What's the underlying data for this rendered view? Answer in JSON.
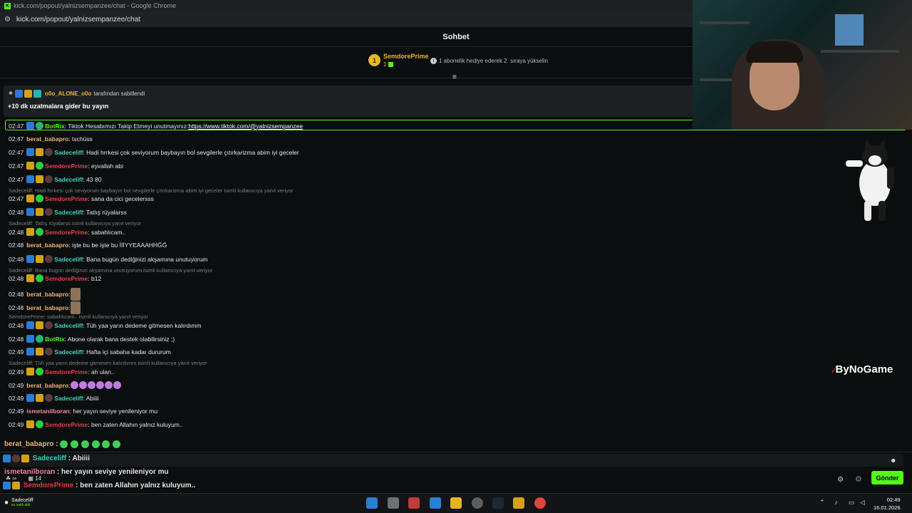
{
  "window": {
    "title": "kick.com/popout/yalnizsempanzee/chat - Google Chrome",
    "url": "kick.com/popout/yalnizsempanzee/chat"
  },
  "chat": {
    "header": "Sohbet",
    "leader": {
      "rank": "1",
      "name": "SemdorePrime",
      "count": "1"
    },
    "sub_hint": "1 abonelik hediye ederek 2. sıraya yükselin",
    "pinned": {
      "pinner": "o0o_ALONE_o0o",
      "pinned_by_text": "tarafından sabitlendi",
      "message": "+10 dk uzatmalara gider bu yayın"
    },
    "messages": [
      {
        "time": "02:47",
        "user": "BotRix",
        "text": ": Tiktok Hesabımızı Takip Etmeyi unutmayınız: ",
        "link": "https://www.tiktok.com/@yalnizsempanzee"
      },
      {
        "time": "02:47",
        "user": "berat_babapro",
        "text": ": tschüss"
      },
      {
        "time": "02:47",
        "user": "Sadeceliff",
        "text": ": Hadi hrrkesi çok seviyorum baybayın bol sevgilerle çıtırkarizma abim iyi geceler"
      },
      {
        "time": "02:47",
        "user": "SemdorePrime",
        "text": ": eyvallah abi"
      },
      {
        "time": "02:47",
        "user": "Sadeceliff",
        "text": ": 43 80"
      },
      {
        "reply": "Sadeceliff: Hadi hrrkesi çok seviyorum baybayın bol sevgilerle çıtırkarizma abim iyi geceler isimli kullanıcıya yanıt veriyor"
      },
      {
        "time": "02:47",
        "user": "SemdorePrime",
        "text": ": sana da cici gecelersss"
      },
      {
        "time": "02:48",
        "user": "Sadeceliff",
        "text": ": Tatlış rüyalarss"
      },
      {
        "reply": "Sadeceliff: Tatlış rüyalarss isimli kullanıcıya yanıt veriyor"
      },
      {
        "time": "02:48",
        "user": "SemdorePrime",
        "text": ": sabahlıcam.."
      },
      {
        "time": "02:48",
        "user": "berat_babapro",
        "text": ": işte bu be işte bu İİİYYEAAAHHĞĞ"
      },
      {
        "time": "02:48",
        "user": "Sadeceliff",
        "text": ": Bana bugün dediğinizi akşamına unutuyorum"
      },
      {
        "reply": "Sadeceliff: Bana bugün dediğinizi akşamına unutuyorum isimli kullanıcıya yanıt veriyor"
      },
      {
        "time": "02:48",
        "user": "SemdorePrime",
        "text": ": b12"
      },
      {
        "time": "02:48",
        "user": "berat_babapro",
        "text": ":"
      },
      {
        "time": "02:48",
        "user": "berat_babapro",
        "text": ":"
      },
      {
        "reply": "SemdorePrime: sabahlıcam.. isimli kullanıcıya yanıt veriyor"
      },
      {
        "time": "02:48",
        "user": "Sadeceliff",
        "text": ": Tüh yaa yarın dedeme gitmesen kalırdımm"
      },
      {
        "time": "02:48",
        "user": "BotRix",
        "text": ": Abone olarak bana destek olabilirsiniz ;)"
      },
      {
        "time": "02:49",
        "user": "Sadeceliff",
        "text": ": Hafta içi sabaha kadar dururum"
      },
      {
        "reply": "Sadeceliff: Tüh yaa yarın dedeme gitmesen kalırdımm isimli kullanıcıya yanıt veriyor"
      },
      {
        "time": "02:49",
        "user": "SemdorePrime",
        "text": ": ah ulan.."
      },
      {
        "time": "02:49",
        "user": "berat_babapro",
        "text": ":"
      },
      {
        "time": "02:49",
        "user": "Sadeceliff",
        "text": ": Abiiii"
      },
      {
        "time": "02:49",
        "user": "ismetanilboran",
        "text": ": her yayın seviye yenileniyor mu"
      },
      {
        "time": "02:49",
        "user": "SemdorePrime",
        "text": ": ben zaten Allahın yalnız kuluyum.."
      }
    ],
    "overlay": [
      {
        "user": "berat_babapro",
        "text": " :"
      },
      {
        "user": "Sadeceliff",
        "text": " : Abiiii"
      },
      {
        "user": "ismetanilboran",
        "text": " : her yayın seviye yenileniyor mu"
      },
      {
        "user": "SemdorePrime",
        "text": " : ben zaten Allahın yalnız kuluyum.."
      }
    ],
    "send_label": "Gönder",
    "viewer_stats": {
      "a": "∞",
      "b": "14"
    }
  },
  "taskbar": {
    "user": "Sadeceliff",
    "user_sub": "su vakti aldi",
    "time": "02:49",
    "date": "16.01.2026"
  },
  "watermark": {
    "text": "ByNoGame"
  },
  "colors": {
    "kick_green": "#53fc18",
    "gold": "#e9b52a",
    "red_user": "#e83e4d",
    "teal_user": "#41d6c0"
  }
}
